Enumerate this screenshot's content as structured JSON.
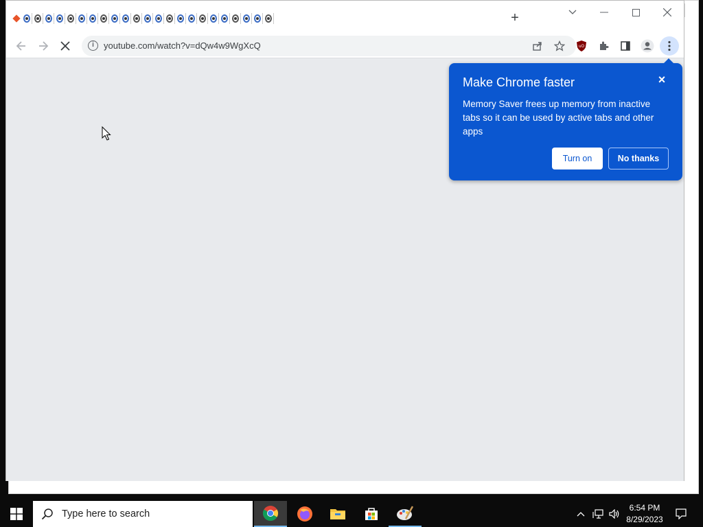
{
  "browser": {
    "url": "youtube.com/watch?v=dQw4w9WgXcQ",
    "tab_count": 23,
    "new_tab_label": "+"
  },
  "popup": {
    "title": "Make Chrome faster",
    "body": "Memory Saver frees up memory from inactive tabs so it can be used by active tabs and other apps",
    "turn_on": "Turn on",
    "no_thanks": "No thanks",
    "close_glyph": "×"
  },
  "taskbar": {
    "search_placeholder": "Type here to search",
    "time": "6:54 PM",
    "date": "8/29/2023"
  },
  "colors": {
    "popup_bg": "#0b57d0",
    "toolbar_bg": "#ffffff",
    "content_bg": "#e8eaed"
  },
  "icons": [
    "back-arrow-icon",
    "forward-arrow-icon",
    "stop-loading-icon",
    "site-info-icon",
    "share-icon",
    "bookmark-star-icon",
    "ublock-origin-icon",
    "extensions-puzzle-icon",
    "side-panel-icon",
    "profile-icon",
    "menu-kebab-icon",
    "windows-start-icon",
    "search-icon",
    "chrome-icon",
    "firefox-icon",
    "file-explorer-icon",
    "microsoft-store-icon",
    "paint-icon",
    "chevron-up-icon",
    "network-icon",
    "volume-icon",
    "notification-icon"
  ]
}
